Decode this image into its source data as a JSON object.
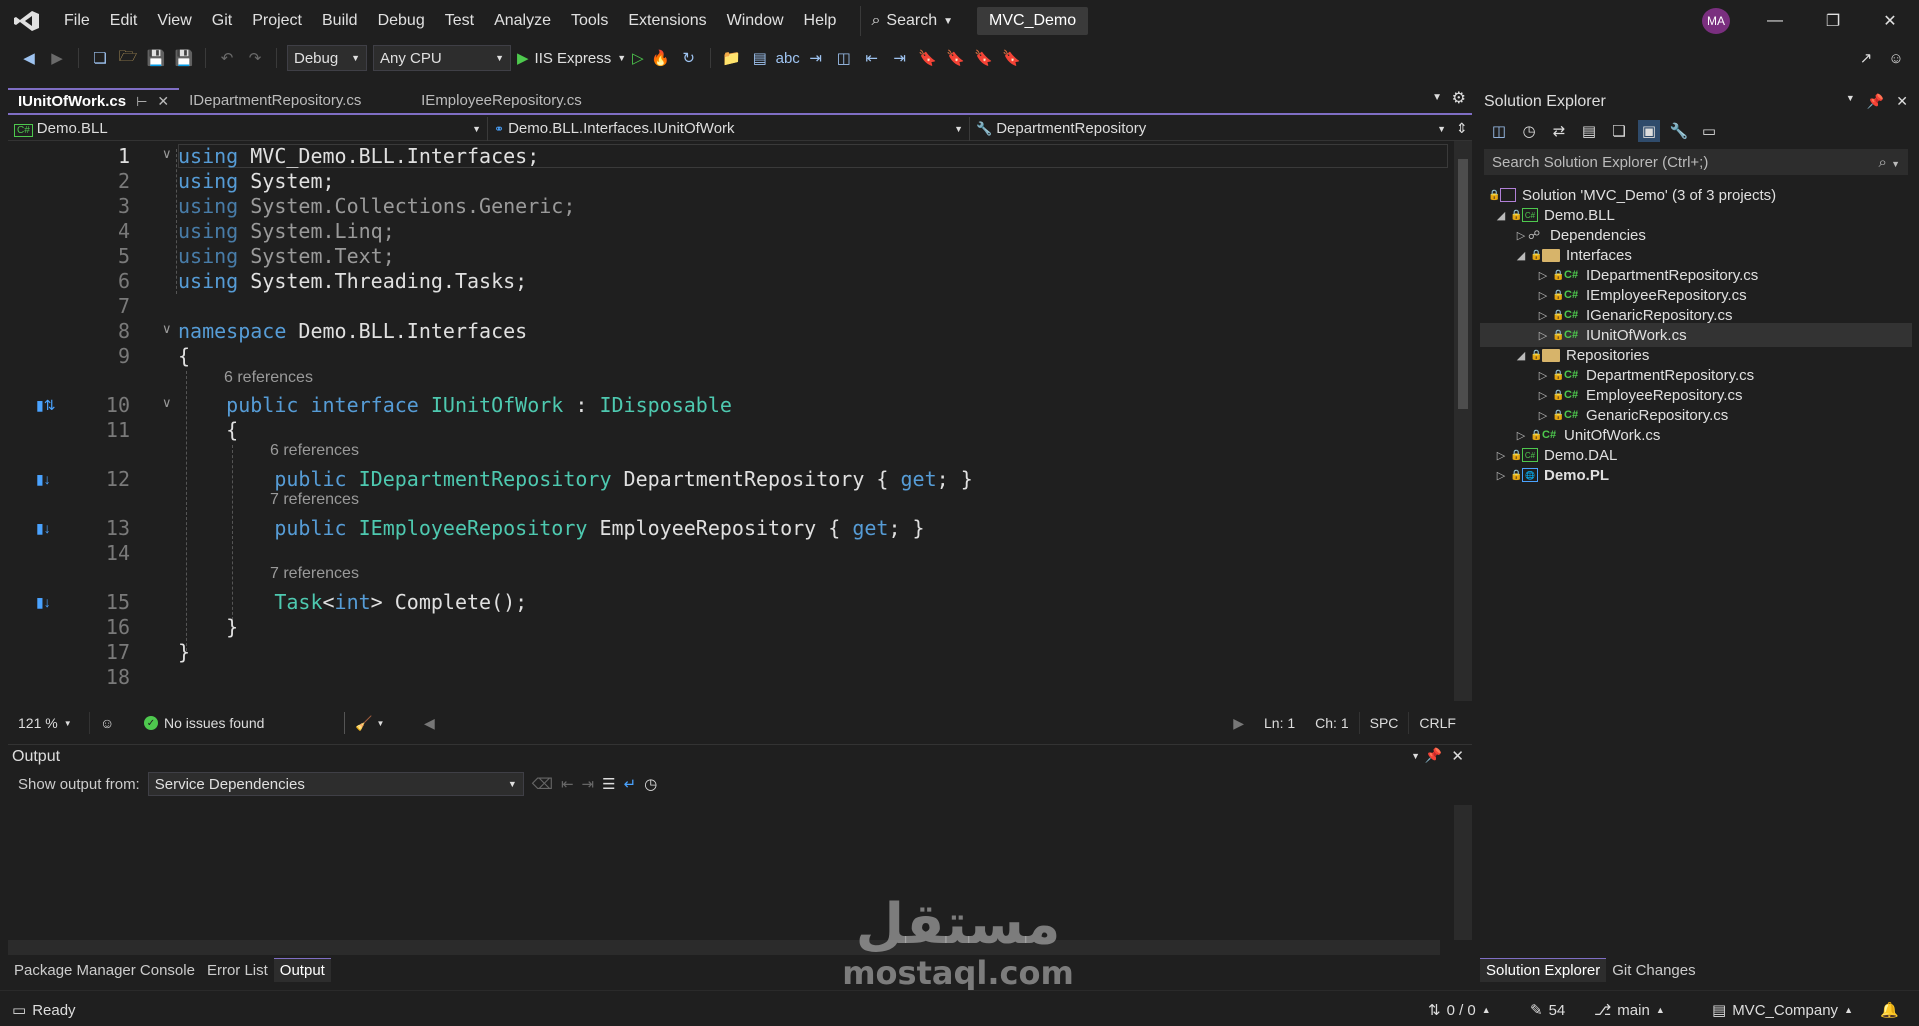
{
  "menu": {
    "items": [
      "File",
      "Edit",
      "View",
      "Git",
      "Project",
      "Build",
      "Debug",
      "Test",
      "Analyze",
      "Tools",
      "Extensions",
      "Window",
      "Help"
    ],
    "search_label": "Search",
    "solution_name": "MVC_Demo",
    "avatar_initials": "MA"
  },
  "toolbar": {
    "config": "Debug",
    "platform": "Any CPU",
    "run_target": "IIS Express"
  },
  "tabs": [
    {
      "label": "IUnitOfWork.cs",
      "active": true
    },
    {
      "label": "IDepartmentRepository.cs",
      "active": false
    },
    {
      "label": "IEmployeeRepository.cs",
      "active": false
    }
  ],
  "nav": {
    "project": "Demo.BLL",
    "type": "Demo.BLL.Interfaces.IUnitOfWork",
    "member": "DepartmentRepository"
  },
  "code": {
    "line_numbers": [
      "1",
      "2",
      "3",
      "4",
      "5",
      "6",
      "7",
      "8",
      "9",
      "10",
      "11",
      "12",
      "13",
      "14",
      "15",
      "16",
      "17",
      "18"
    ],
    "refs": {
      "interface": "6 references",
      "dept": "6 references",
      "emp": "7 references",
      "complete": "7 references"
    }
  },
  "editor_status": {
    "zoom": "121 %",
    "issues": "No issues found",
    "ln": "Ln: 1",
    "ch": "Ch: 1",
    "spc": "SPC",
    "eol": "CRLF"
  },
  "output": {
    "title": "Output",
    "show_from_label": "Show output from:",
    "source": "Service Dependencies"
  },
  "bottom_tabs": [
    "Package Manager Console",
    "Error List",
    "Output"
  ],
  "solution_explorer": {
    "title": "Solution Explorer",
    "search_placeholder": "Search Solution Explorer (Ctrl+;)",
    "tree": {
      "solution": "Solution 'MVC_Demo' (3 of 3 projects)",
      "bll": "Demo.BLL",
      "dependencies": "Dependencies",
      "interfaces": "Interfaces",
      "i_dept": "IDepartmentRepository.cs",
      "i_emp": "IEmployeeRepository.cs",
      "i_gen": "IGenaricRepository.cs",
      "i_uow": "IUnitOfWork.cs",
      "repositories": "Repositories",
      "dept": "DepartmentRepository.cs",
      "emp": "EmployeeRepository.cs",
      "gen": "GenaricRepository.cs",
      "uow": "UnitOfWork.cs",
      "dal": "Demo.DAL",
      "pl": "Demo.PL"
    },
    "bottom_tabs": [
      "Solution Explorer",
      "Git Changes"
    ]
  },
  "statusbar": {
    "ready": "Ready",
    "sync": "0 / 0",
    "changes": "54",
    "branch": "main",
    "repo": "MVC_Company"
  },
  "watermark": {
    "arabic": "مستقل",
    "latin": "mostaql.com"
  },
  "colors": {
    "accent": "#7f6ec4",
    "keyword": "#569cd6",
    "type": "#4ec9b0",
    "background": "#1f1f1f"
  }
}
